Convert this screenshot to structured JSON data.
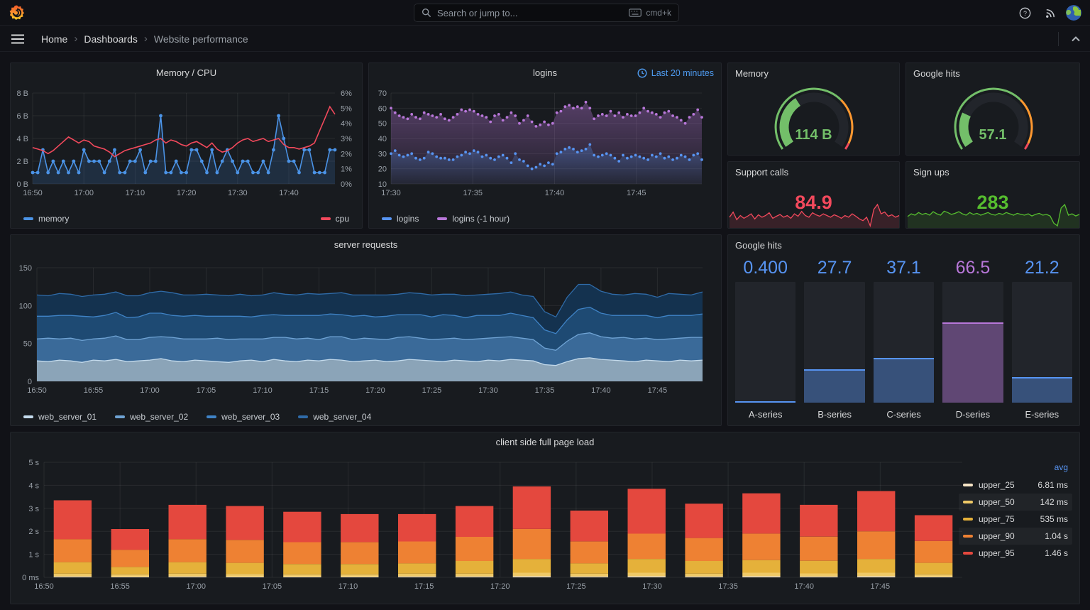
{
  "topnav": {
    "search_placeholder": "Search or jump to...",
    "shortcut_label": "cmd+k"
  },
  "breadcrumb": {
    "home": "Home",
    "dashboards": "Dashboards",
    "current": "Website performance"
  },
  "accent": {
    "time_range_blue": "#4E9BF0",
    "legend_header_blue": "#5794F2",
    "gauge_green": "#73BF69",
    "gauge_orange": "#FF9830",
    "gauge_red": "#F2495C"
  },
  "chart_data": [
    {
      "id": "memory_cpu",
      "type": "line",
      "title": "Memory / CPU",
      "x_ticks": [
        "16:50",
        "17:00",
        "17:10",
        "17:20",
        "17:30",
        "17:40"
      ],
      "y_left": {
        "ticks": [
          "0 B",
          "2 B",
          "4 B",
          "6 B",
          "8 B"
        ],
        "min": 0,
        "max": 8
      },
      "y_right": {
        "ticks": [
          "0%",
          "1%",
          "2%",
          "3%",
          "4%",
          "5%",
          "6%"
        ],
        "min": 0,
        "max": 6
      },
      "series": [
        {
          "name": "memory",
          "axis": "left",
          "color": "#4B93E6",
          "values": [
            1,
            1,
            3,
            1,
            2,
            1,
            2,
            1,
            2,
            1,
            3,
            2,
            2,
            2,
            1,
            2,
            3,
            1,
            1,
            2,
            2,
            3,
            1,
            2,
            2,
            6,
            1,
            1,
            2,
            1,
            1,
            3,
            3,
            2,
            1,
            3,
            1,
            2,
            3,
            2,
            1,
            2,
            2,
            1,
            1,
            2,
            1,
            3,
            6,
            4,
            2,
            2,
            1,
            3,
            3,
            1,
            1,
            1,
            3,
            3
          ]
        },
        {
          "name": "cpu",
          "axis": "right",
          "color": "#F2495C",
          "values": [
            2.4,
            2.3,
            2.2,
            2.0,
            2.2,
            2.5,
            2.8,
            3.1,
            2.9,
            2.7,
            2.9,
            2.8,
            2.5,
            2.4,
            2.3,
            2.1,
            1.8,
            2.0,
            2.2,
            2.3,
            2.4,
            2.5,
            2.6,
            2.7,
            2.9,
            3.0,
            2.7,
            2.9,
            2.8,
            2.6,
            2.5,
            2.7,
            2.8,
            2.6,
            2.4,
            2.7,
            2.3,
            2.1,
            2.2,
            2.4,
            2.7,
            2.9,
            3.0,
            2.8,
            2.9,
            3.0,
            2.8,
            2.9,
            3.0,
            2.6,
            2.4,
            2.4,
            2.3,
            2.4,
            2.5,
            2.7,
            3.5,
            4.3,
            5.1,
            4.6
          ]
        }
      ]
    },
    {
      "id": "logins",
      "type": "scatter",
      "title": "logins",
      "time_range_label": "Last 20 minutes",
      "x_ticks": [
        "17:30",
        "17:35",
        "17:40",
        "17:45"
      ],
      "y": {
        "ticks": [
          "10",
          "20",
          "30",
          "40",
          "50",
          "60",
          "70"
        ],
        "min": 10,
        "max": 70
      },
      "series": [
        {
          "name": "logins (-1 hour)",
          "color": "#B877D9",
          "values": [
            60,
            57,
            55,
            54,
            53,
            56,
            54,
            53,
            57,
            56,
            55,
            54,
            56,
            53,
            52,
            54,
            56,
            59,
            58,
            59,
            58,
            56,
            55,
            54,
            51,
            55,
            56,
            52,
            54,
            57,
            55,
            50,
            52,
            55,
            51,
            48,
            49,
            51,
            49,
            50,
            57,
            58,
            61,
            62,
            60,
            61,
            60,
            64,
            60,
            53,
            55,
            56,
            55,
            58,
            55,
            57,
            54,
            56,
            55,
            55,
            57,
            60,
            58,
            57,
            56,
            54,
            57,
            58,
            55,
            54,
            52,
            50,
            54,
            56,
            59,
            54
          ]
        },
        {
          "name": "logins",
          "color": "#5794F2",
          "values": [
            30,
            32,
            29,
            28,
            29,
            30,
            27,
            26,
            27,
            31,
            30,
            28,
            27,
            27,
            26,
            26,
            28,
            29,
            31,
            30,
            32,
            31,
            28,
            29,
            27,
            26,
            28,
            29,
            27,
            24,
            30,
            26,
            25,
            22,
            20,
            21,
            23,
            22,
            24,
            23,
            30,
            31,
            33,
            34,
            33,
            31,
            32,
            33,
            36,
            29,
            28,
            29,
            30,
            29,
            27,
            25,
            29,
            27,
            28,
            29,
            28,
            27,
            26,
            29,
            28,
            30,
            27,
            28,
            26,
            27,
            29,
            28,
            26,
            29,
            30,
            26
          ]
        }
      ]
    },
    {
      "id": "memory_gauge",
      "type": "gauge",
      "title": "Memory",
      "value": "114 B",
      "percent": 37,
      "color": "#73BF69"
    },
    {
      "id": "google_gauge",
      "type": "gauge",
      "title": "Google hits",
      "value": "57.1",
      "percent": 24,
      "color": "#73BF69"
    },
    {
      "id": "support_calls",
      "type": "sparkline",
      "title": "Support calls",
      "value": "84.9",
      "color": "#F2495C",
      "fill": "rgba(242,73,92,0.15)",
      "values": [
        55,
        70,
        48,
        60,
        52,
        58,
        65,
        50,
        62,
        55,
        60,
        68,
        52,
        58,
        63,
        55,
        60,
        52,
        65,
        58,
        72,
        60,
        55,
        68,
        62,
        58,
        65,
        60,
        55,
        62,
        58,
        52,
        60,
        55,
        65,
        58,
        50,
        45,
        55,
        30,
        78,
        92,
        65,
        70,
        58,
        62,
        55,
        60
      ]
    },
    {
      "id": "sign_ups",
      "type": "sparkline",
      "title": "Sign ups",
      "value": "283",
      "color": "#56BD2F",
      "fill": "rgba(86,189,47,0.15)",
      "values": [
        50,
        60,
        55,
        65,
        58,
        62,
        55,
        68,
        60,
        55,
        70,
        65,
        58,
        62,
        68,
        60,
        55,
        65,
        58,
        62,
        55,
        60,
        65,
        58,
        55,
        62,
        58,
        65,
        60,
        55,
        62,
        58,
        55,
        60,
        52,
        58,
        62,
        55,
        58,
        52,
        25,
        15,
        82,
        95,
        55,
        60,
        52,
        58
      ]
    },
    {
      "id": "server_requests",
      "type": "area",
      "title": "server requests",
      "stacked": true,
      "x_ticks": [
        "16:50",
        "16:55",
        "17:00",
        "17:05",
        "17:10",
        "17:15",
        "17:20",
        "17:25",
        "17:30",
        "17:35",
        "17:40",
        "17:45"
      ],
      "y": {
        "ticks": [
          "0",
          "50",
          "100",
          "150"
        ],
        "min": 0,
        "max": 150
      },
      "series": [
        {
          "name": "web_server_01",
          "line": "#C3DAEC",
          "fill": "#8BA4B8",
          "values": [
            27,
            26,
            28,
            27,
            25,
            28,
            27,
            29,
            26,
            27,
            28,
            30,
            27,
            26,
            28,
            27,
            26,
            25,
            27,
            28,
            26,
            29,
            27,
            26,
            28,
            27,
            29,
            28,
            26,
            27,
            28,
            26,
            27,
            29,
            28,
            27,
            26,
            28,
            27,
            26,
            28,
            27,
            29,
            28,
            27,
            22,
            21,
            26,
            30,
            31,
            29,
            28,
            27,
            26,
            28,
            27,
            26,
            28,
            27,
            28
          ]
        },
        {
          "name": "web_server_02",
          "line": "#6FA3D4",
          "fill": "#3A6A99",
          "values": [
            29,
            31,
            28,
            30,
            29,
            28,
            30,
            31,
            29,
            28,
            30,
            29,
            31,
            30,
            28,
            29,
            31,
            30,
            29,
            28,
            30,
            29,
            31,
            30,
            29,
            28,
            30,
            31,
            29,
            30,
            28,
            29,
            31,
            30,
            29,
            28,
            30,
            29,
            28,
            30,
            29,
            31,
            30,
            29,
            28,
            22,
            20,
            27,
            32,
            33,
            30,
            29,
            31,
            30,
            29,
            28,
            30,
            29,
            31,
            30
          ]
        },
        {
          "name": "web_server_03",
          "line": "#3F83C6",
          "fill": "#1E4A73",
          "values": [
            30,
            29,
            31,
            30,
            32,
            29,
            30,
            31,
            29,
            30,
            32,
            31,
            29,
            30,
            31,
            30,
            29,
            31,
            30,
            29,
            31,
            30,
            29,
            31,
            30,
            32,
            30,
            29,
            31,
            30,
            29,
            31,
            30,
            29,
            31,
            30,
            32,
            30,
            29,
            31,
            30,
            29,
            31,
            30,
            29,
            24,
            22,
            28,
            33,
            34,
            31,
            30,
            29,
            31,
            30,
            29,
            31,
            30,
            29,
            31
          ]
        },
        {
          "name": "web_server_04",
          "line": "#2F6BA8",
          "fill": "#14324F",
          "values": [
            28,
            27,
            29,
            28,
            26,
            29,
            28,
            27,
            29,
            28,
            27,
            29,
            30,
            28,
            27,
            29,
            28,
            27,
            29,
            28,
            27,
            29,
            28,
            27,
            29,
            28,
            27,
            29,
            28,
            27,
            29,
            28,
            27,
            29,
            28,
            29,
            27,
            28,
            29,
            27,
            28,
            29,
            28,
            27,
            28,
            24,
            22,
            30,
            33,
            30,
            29,
            28,
            27,
            29,
            28,
            27,
            29,
            28,
            27,
            29
          ]
        }
      ]
    },
    {
      "id": "google_hits_bars",
      "type": "bar",
      "title": "Google hits",
      "max": 100,
      "bars": [
        {
          "label": "A-series",
          "value": "0.400",
          "num": 0.4,
          "fill": "rgba(87,148,242,0.40)",
          "edge": "#5794F2",
          "text": "#5794F2"
        },
        {
          "label": "B-series",
          "value": "27.7",
          "num": 27.7,
          "fill": "rgba(87,148,242,0.40)",
          "edge": "#5794F2",
          "text": "#5794F2"
        },
        {
          "label": "C-series",
          "value": "37.1",
          "num": 37.1,
          "fill": "rgba(87,148,242,0.40)",
          "edge": "#5794F2",
          "text": "#5794F2"
        },
        {
          "label": "D-series",
          "value": "66.5",
          "num": 66.5,
          "fill": "rgba(184,119,217,0.42)",
          "edge": "#B877D9",
          "text": "#B877D9"
        },
        {
          "label": "E-series",
          "value": "21.2",
          "num": 21.2,
          "fill": "rgba(87,148,242,0.40)",
          "edge": "#5794F2",
          "text": "#5794F2"
        }
      ]
    },
    {
      "id": "client_load",
      "type": "bar",
      "stacked": true,
      "title": "client side full page load",
      "x_ticks": [
        "16:50",
        "16:55",
        "17:00",
        "17:05",
        "17:10",
        "17:15",
        "17:20",
        "17:25",
        "17:30",
        "17:35",
        "17:40",
        "17:45"
      ],
      "y_ticks": [
        "0 ms",
        "1 s",
        "2 s",
        "3 s",
        "4 s",
        "5 s"
      ],
      "y_max": 5,
      "colors": [
        "#F5E3C5",
        "#EFC967",
        "#E5B13A",
        "#EE8133",
        "#E4483E"
      ],
      "series_names": [
        "upper_25",
        "upper_50",
        "upper_75",
        "upper_90",
        "upper_95"
      ],
      "bars": [
        [
          0.04,
          0.12,
          0.5,
          1.0,
          1.69
        ],
        [
          0.03,
          0.1,
          0.32,
          0.75,
          0.9
        ],
        [
          0.04,
          0.12,
          0.5,
          1.0,
          1.49
        ],
        [
          0.03,
          0.12,
          0.48,
          1.0,
          1.47
        ],
        [
          0.03,
          0.1,
          0.45,
          0.95,
          1.32
        ],
        [
          0.03,
          0.1,
          0.45,
          0.95,
          1.22
        ],
        [
          0.04,
          0.12,
          0.45,
          0.95,
          1.19
        ],
        [
          0.04,
          0.12,
          0.55,
          1.05,
          1.34
        ],
        [
          0.05,
          0.15,
          0.6,
          1.3,
          1.85
        ],
        [
          0.04,
          0.12,
          0.45,
          0.95,
          1.34
        ],
        [
          0.05,
          0.15,
          0.6,
          1.1,
          1.95
        ],
        [
          0.04,
          0.12,
          0.55,
          1.0,
          1.49
        ],
        [
          0.05,
          0.15,
          0.55,
          1.15,
          1.75
        ],
        [
          0.04,
          0.13,
          0.55,
          1.05,
          1.38
        ],
        [
          0.05,
          0.15,
          0.6,
          1.2,
          1.75
        ],
        [
          0.03,
          0.1,
          0.5,
          0.95,
          1.12
        ]
      ],
      "legend": {
        "header": "avg",
        "rows": [
          {
            "name": "upper_25",
            "value": "6.81 ms",
            "color": "#F5E3C5",
            "shade": false
          },
          {
            "name": "upper_50",
            "value": "142 ms",
            "color": "#EFC967",
            "shade": true
          },
          {
            "name": "upper_75",
            "value": "535 ms",
            "color": "#E5B13A",
            "shade": false
          },
          {
            "name": "upper_90",
            "value": "1.04 s",
            "color": "#EE8133",
            "shade": true
          },
          {
            "name": "upper_95",
            "value": "1.46 s",
            "color": "#E4483E",
            "shade": false
          }
        ]
      }
    }
  ]
}
